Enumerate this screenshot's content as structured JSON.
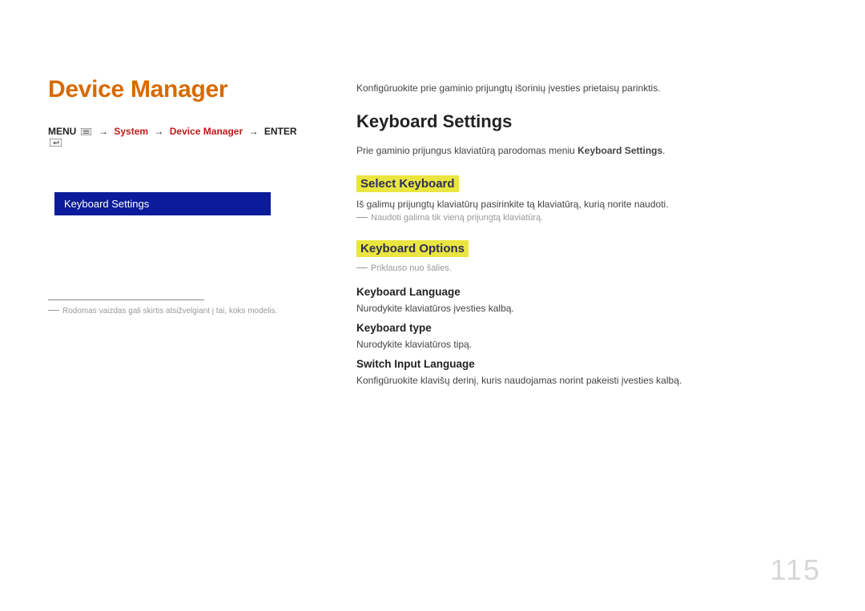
{
  "page_number": "115",
  "left": {
    "title": "Device Manager",
    "breadcrumb": {
      "menu": "MENU",
      "path1": "System",
      "path2": "Device Manager",
      "enter": "ENTER"
    },
    "selector": {
      "item": "Keyboard Settings"
    },
    "footnote": "Rodomas vaizdas gali skirtis atsižvelgiant į tai, koks modelis."
  },
  "right": {
    "intro": "Konfigūruokite prie gaminio prijungtų išorinių įvesties prietaisų parinktis.",
    "h2": "Keyboard Settings",
    "para1_a": "Prie gaminio prijungus klaviatūrą parodomas meniu ",
    "para1_b": "Keyboard Settings",
    "para1_c": ".",
    "select_keyboard": {
      "heading": "Select Keyboard",
      "text": "Iš galimų prijungtų klaviatūrų pasirinkite tą klaviatūrą, kurią norite naudoti.",
      "note": "Naudoti galima tik vieną prijungtą klaviatūrą."
    },
    "keyboard_options": {
      "heading": "Keyboard Options",
      "note": "Priklauso nuo šalies.",
      "lang": {
        "h": "Keyboard Language",
        "t": "Nurodykite klaviatūros įvesties kalbą."
      },
      "type": {
        "h": "Keyboard type",
        "t": "Nurodykite klaviatūros tipą."
      },
      "switch": {
        "h": "Switch Input Language",
        "t": "Konfigūruokite klavišų derinį, kuris naudojamas norint pakeisti įvesties kalbą."
      }
    }
  }
}
